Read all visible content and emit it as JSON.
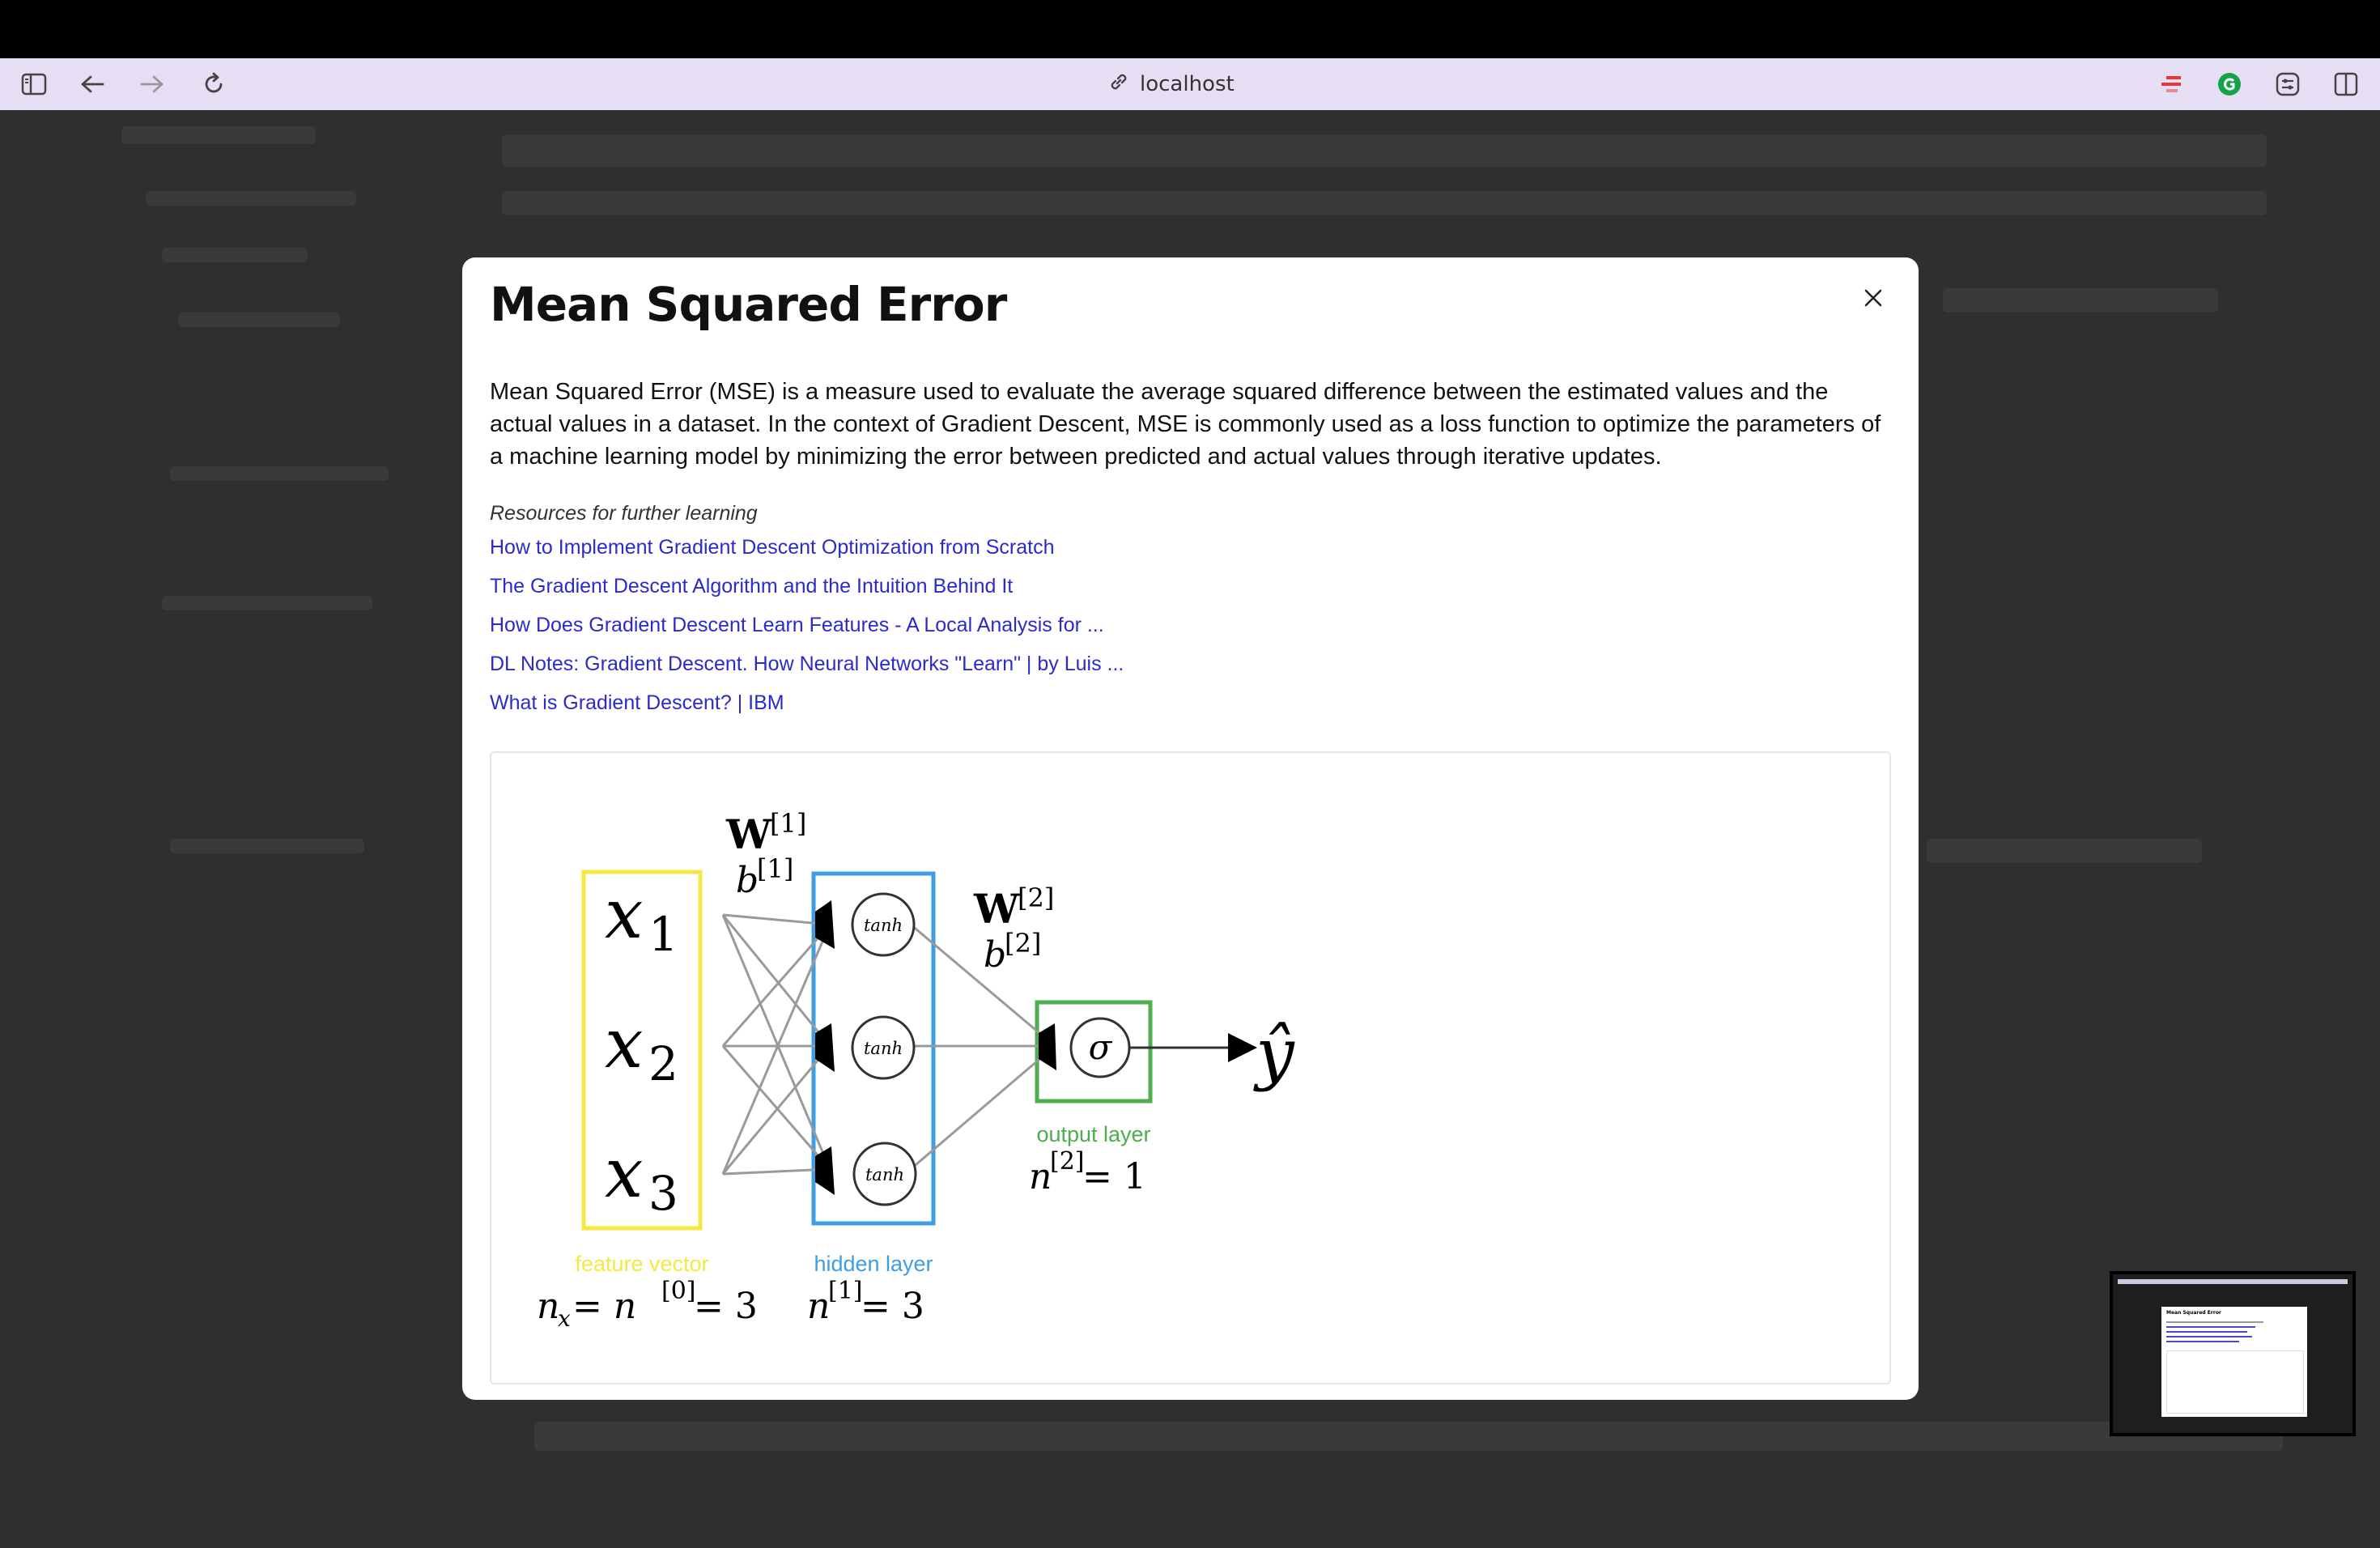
{
  "browser": {
    "url": "localhost",
    "icons": [
      "sidebar-icon",
      "back-arrow-icon",
      "forward-arrow-icon",
      "reload-icon",
      "link-icon",
      "extension-icon",
      "grammarly-icon",
      "adjust-icon",
      "split-view-icon"
    ]
  },
  "modal": {
    "title": "Mean Squared Error",
    "close_icon": "close-icon",
    "description": "Mean Squared Error (MSE) is a measure used to evaluate the average squared difference between the estimated values and the actual values in a dataset. In the context of Gradient Descent, MSE is commonly used as a loss function to optimize the parameters of a machine learning model by minimizing the error between predicted and actual values through iterative updates.",
    "resources_label": "Resources for further learning",
    "links": [
      "How to Implement Gradient Descent Optimization from Scratch",
      "The Gradient Descent Algorithm and the Intuition Behind It",
      "How Does Gradient Descent Learn Features - A Local Analysis for ...",
      "DL Notes: Gradient Descent. How Neural Networks \"Learn\" | by Luis ...",
      "What is Gradient Descent? | IBM"
    ]
  },
  "diagram": {
    "inputs": [
      "x",
      "x",
      "x"
    ],
    "input_subscripts": [
      "1",
      "2",
      "3"
    ],
    "hidden_nodes": [
      "tanh",
      "tanh",
      "tanh"
    ],
    "output_node": "σ",
    "output_symbol": "ŷ",
    "w1": "W",
    "w1_sup": "[1]",
    "b1": "b",
    "b1_sup": "[1]",
    "w2": "W",
    "w2_sup": "[2]",
    "b2": "b",
    "b2_sup": "[2]",
    "label_feature": "feature vector",
    "label_hidden": "hidden layer",
    "label_output": "output layer",
    "eq_input": "n",
    "eq_input_sub": "x",
    "eq_input_rest": " = n",
    "eq_input_sup": "[0]",
    "eq_input_val": " = 3",
    "eq_hidden": "n",
    "eq_hidden_sup": "[1]",
    "eq_hidden_val": " = 3",
    "eq_output": "n",
    "eq_output_sup": "[2]",
    "eq_output_val": " = 1",
    "colors": {
      "feature": "#f4e842",
      "hidden": "#3f9ee0",
      "output": "#4cae4c"
    }
  },
  "minimap": {
    "title": "Mean Squared Error"
  }
}
